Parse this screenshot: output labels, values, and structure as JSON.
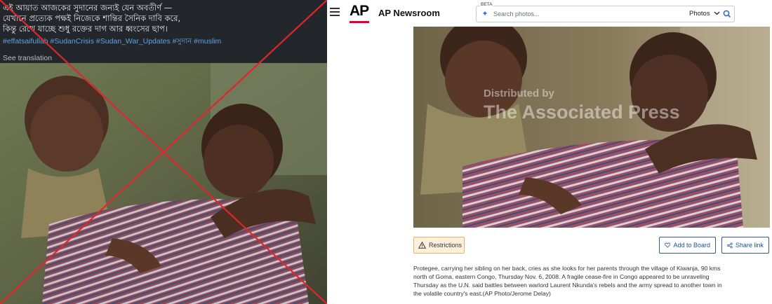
{
  "left_post": {
    "lines": [
      "এই আয়াত আজকের সুদানের জন্যই যেন অবতীর্ণ —",
      "যেখানে প্রত্যেক পক্ষই নিজেকে শান্তির সৈনিক দাবি করে,",
      "কিন্তু রেখে যাচ্ছে শুধু রক্তের দাগ আর ধ্বংসের ছাপ।"
    ],
    "hashtags": "#effatsaifullah #SudanCrisis #Sudan_War_Updates #সুদান #muslim",
    "see_translation": "See translation",
    "x_mark_color": "#e0262b"
  },
  "header": {
    "logo": "AP",
    "brand": "AP Newsroom",
    "search": {
      "badge": "BETA",
      "placeholder": "Search photos...",
      "scope": "Photos"
    }
  },
  "photo": {
    "watermark_line1": "Distributed by",
    "watermark_line2": "The Associated Press"
  },
  "actions": {
    "restrictions": "Restrictions",
    "add_to_board": "Add to Board",
    "share_link": "Share link"
  },
  "caption": "Protegee, carrying her sibling on her back, cries as she looks for her parents through the village of Kiwanja, 90 kms north of Goma, eastern Congo, Thursday Nov. 6, 2008. A fragile cease-fire in Congo appeared to be unraveling Thursday as the U.N. said battles between warlord Laurent Nkunda's rebels and the army spread to another town in the volatile country's east.(AP Photo/Jerome Delay)"
}
